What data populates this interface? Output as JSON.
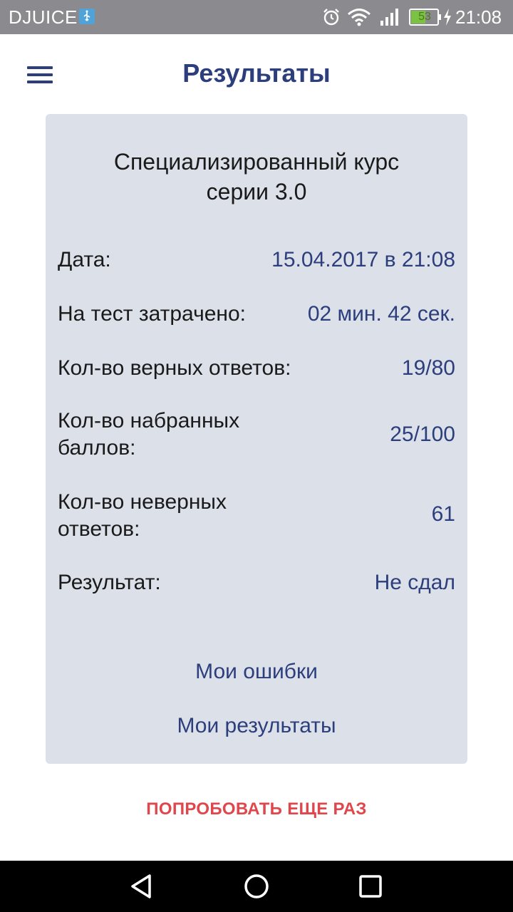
{
  "status_bar": {
    "carrier": "DJUICE",
    "battery": "53",
    "time": "21:08",
    "icons": [
      "usb-icon",
      "alarm-icon",
      "wifi-icon",
      "signal-icon",
      "battery-icon",
      "charging-icon"
    ]
  },
  "header": {
    "title": "Результаты",
    "menu_icon": "hamburger-menu-icon"
  },
  "card": {
    "course_title_line1": "Специализированный курс",
    "course_title_line2": "серии 3.0",
    "rows": [
      {
        "label": "Дата:",
        "value": "15.04.2017 в 21:08"
      },
      {
        "label": "На тест затрачено:",
        "value": "02 мин. 42 сек."
      },
      {
        "label": "Кол-во верных ответов:",
        "value": "19/80"
      },
      {
        "label_line1": "Кол-во набранных",
        "label_line2": "баллов:",
        "value": "25/100"
      },
      {
        "label_line1": "Кол-во неверных",
        "label_line2": "ответов:",
        "value": "61"
      },
      {
        "label": "Результат:",
        "value": "Не сдал"
      }
    ],
    "my_errors_link": "Мои ошибки",
    "my_results_link": "Мои результаты"
  },
  "retry_button": "ПОПРОБОВАТЬ ЕЩЕ РАЗ",
  "nav": {
    "back_icon": "back-triangle-icon",
    "home_icon": "home-circle-icon",
    "recents_icon": "recents-square-icon"
  },
  "colors": {
    "accent": "#2c3e7c",
    "card_bg": "#dbe0e9",
    "retry": "#e0474c",
    "status_bar": "#8a8a8f"
  }
}
